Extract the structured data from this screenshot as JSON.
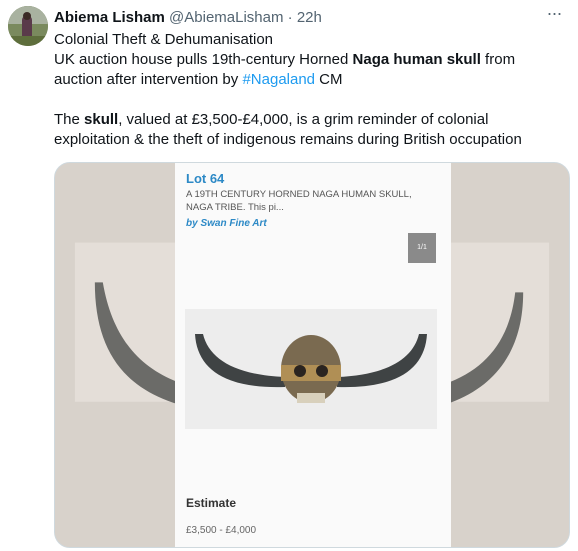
{
  "tweet": {
    "author_name": "Abiema Lisham",
    "handle": "@AbiemaLisham",
    "separator": "·",
    "time": "22h",
    "more_label": "···",
    "line1": "Colonial Theft & Dehumanisation",
    "line2_a": "UK auction house pulls 19th-century Horned ",
    "line2_b": "Naga human skull",
    "line2_c": " from",
    "line3_a": "auction after intervention by ",
    "line3_hashtag": "#Nagaland",
    "line3_b": " CM",
    "line4_a": "The ",
    "line4_b": "skull",
    "line4_c": ", valued at £3,500-£4,000, is a grim reminder of colonial",
    "line5": "exploitation & the theft of indigenous remains during British occupation"
  },
  "media": {
    "lot_title": "Lot 64",
    "lot_desc_1": "A 19TH CENTURY HORNED NAGA HUMAN SKULL,",
    "lot_desc_2": "NAGA TRIBE. This pi...",
    "seller": "by Swan Fine Art",
    "image_counter": "1/1",
    "estimate_label": "Estimate",
    "estimate_value": "£3,500 - £4,000"
  },
  "colors": {
    "link": "#1d9bf0",
    "lot_blue": "#2c89c6",
    "muted": "#536471"
  }
}
